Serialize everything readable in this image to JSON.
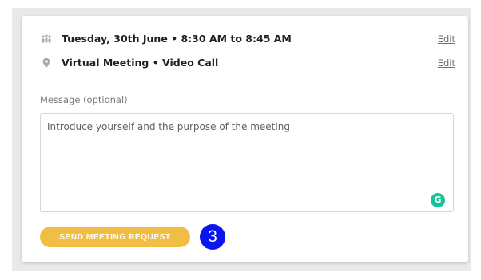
{
  "details": {
    "datetime": {
      "icon": "attendees-icon",
      "text": "Tuesday, 30th June • 8:30 AM to 8:45 AM",
      "edit_label": "Edit"
    },
    "location": {
      "icon": "location-pin-icon",
      "text": "Virtual Meeting • Video Call",
      "edit_label": "Edit"
    }
  },
  "message": {
    "label": "Message (optional)",
    "placeholder": "Introduce yourself and the purpose of the meeting",
    "value": ""
  },
  "grammarly": {
    "icon": "grammarly-icon",
    "glyph": "G",
    "color": "#15c39a"
  },
  "send_button": {
    "label": "SEND MEETING REQUEST",
    "color": "#f2bd44"
  },
  "step_badge": {
    "number": "3",
    "color": "#0a14ee"
  }
}
